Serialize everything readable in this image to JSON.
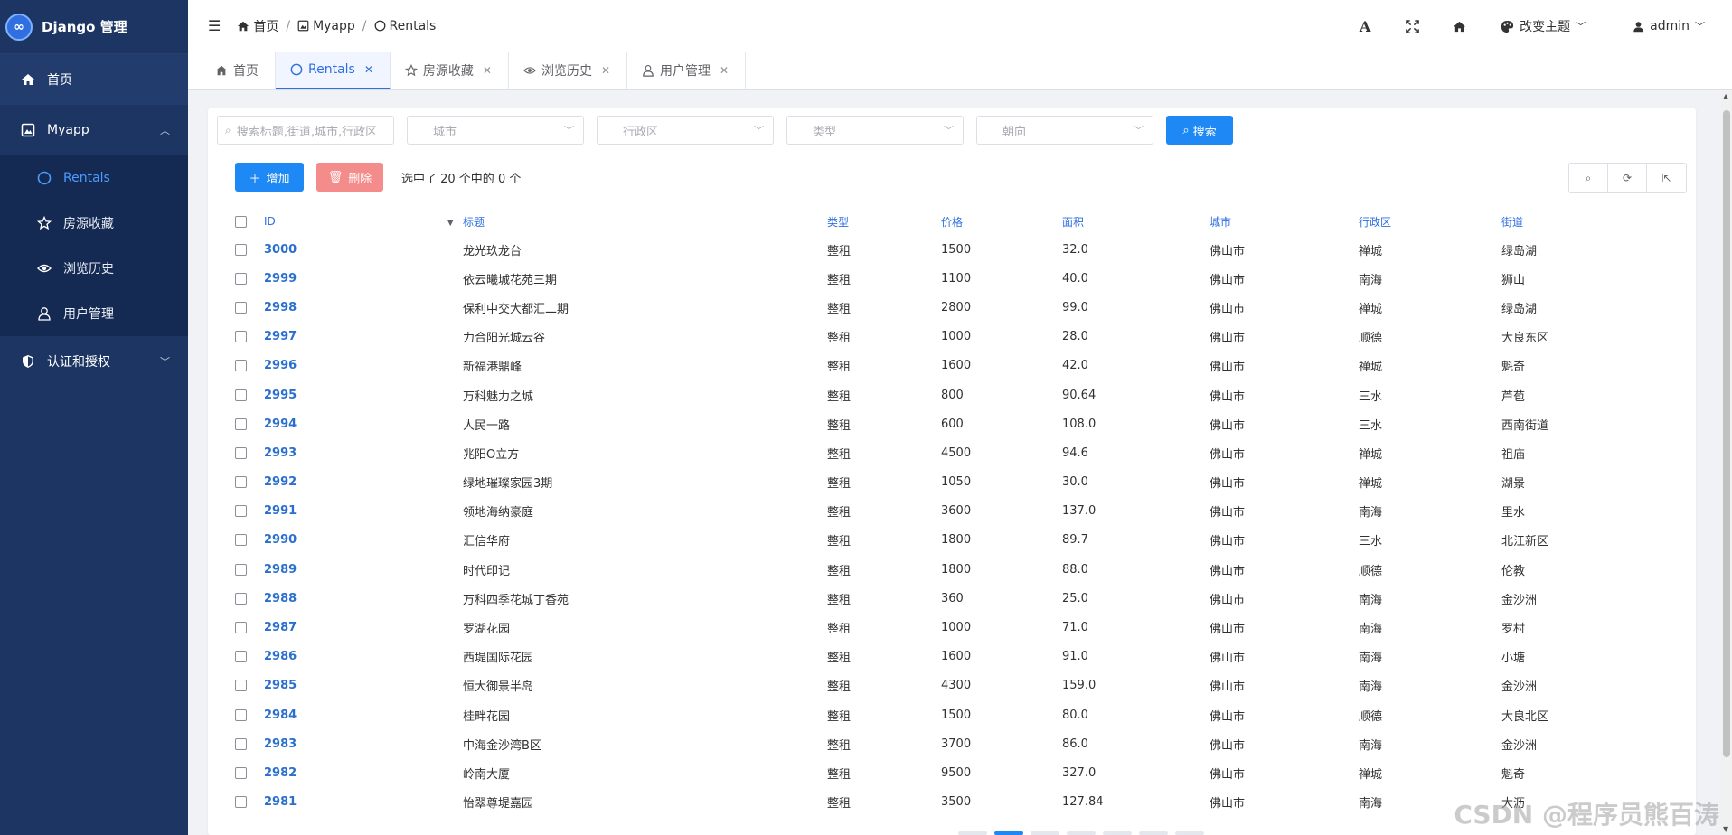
{
  "sidebar": {
    "brand": "Django 管理",
    "items": [
      {
        "label": "首页"
      },
      {
        "label": "Myapp"
      },
      {
        "label": "认证和授权"
      }
    ],
    "sub_items": [
      {
        "label": "Rentals"
      },
      {
        "label": "房源收藏"
      },
      {
        "label": "浏览历史"
      },
      {
        "label": "用户管理"
      }
    ]
  },
  "header": {
    "breadcrumb": [
      {
        "label": "首页"
      },
      {
        "label": "Myapp"
      },
      {
        "label": "Rentals"
      }
    ],
    "theme_label": "改变主题",
    "user_label": "admin"
  },
  "tabs": [
    {
      "label": "首页"
    },
    {
      "label": "Rentals"
    },
    {
      "label": "房源收藏"
    },
    {
      "label": "浏览历史"
    },
    {
      "label": "用户管理"
    }
  ],
  "filters": {
    "search_placeholder": "搜索标题,街道,城市,行政区",
    "city_placeholder": "城市",
    "district_placeholder": "行政区",
    "type_placeholder": "类型",
    "orientation_placeholder": "朝向",
    "search_button": "搜索"
  },
  "actions": {
    "add_label": "增加",
    "delete_label": "删除",
    "selection_text": "选中了 20 个中的 0 个"
  },
  "table": {
    "columns": [
      "ID",
      "标题",
      "类型",
      "价格",
      "面积",
      "城市",
      "行政区",
      "街道"
    ],
    "rows": [
      {
        "id": "3000",
        "title": "龙光玖龙台",
        "type": "整租",
        "price": "1500",
        "area": "32.0",
        "city": "佛山市",
        "district": "禅城",
        "street": "绿岛湖"
      },
      {
        "id": "2999",
        "title": "依云曦城花苑三期",
        "type": "整租",
        "price": "1100",
        "area": "40.0",
        "city": "佛山市",
        "district": "南海",
        "street": "狮山"
      },
      {
        "id": "2998",
        "title": "保利中交大都汇二期",
        "type": "整租",
        "price": "2800",
        "area": "99.0",
        "city": "佛山市",
        "district": "禅城",
        "street": "绿岛湖"
      },
      {
        "id": "2997",
        "title": "力合阳光城云谷",
        "type": "整租",
        "price": "1000",
        "area": "28.0",
        "city": "佛山市",
        "district": "顺德",
        "street": "大良东区"
      },
      {
        "id": "2996",
        "title": "新福港鼎峰",
        "type": "整租",
        "price": "1600",
        "area": "42.0",
        "city": "佛山市",
        "district": "禅城",
        "street": "魁奇"
      },
      {
        "id": "2995",
        "title": "万科魅力之城",
        "type": "整租",
        "price": "800",
        "area": "90.64",
        "city": "佛山市",
        "district": "三水",
        "street": "芦苞"
      },
      {
        "id": "2994",
        "title": "人民一路",
        "type": "整租",
        "price": "600",
        "area": "108.0",
        "city": "佛山市",
        "district": "三水",
        "street": "西南街道"
      },
      {
        "id": "2993",
        "title": "兆阳O立方",
        "type": "整租",
        "price": "4500",
        "area": "94.6",
        "city": "佛山市",
        "district": "禅城",
        "street": "祖庙"
      },
      {
        "id": "2992",
        "title": "绿地璀璨家园3期",
        "type": "整租",
        "price": "1050",
        "area": "30.0",
        "city": "佛山市",
        "district": "禅城",
        "street": "湖景"
      },
      {
        "id": "2991",
        "title": "领地海纳豪庭",
        "type": "整租",
        "price": "3600",
        "area": "137.0",
        "city": "佛山市",
        "district": "南海",
        "street": "里水"
      },
      {
        "id": "2990",
        "title": "汇信华府",
        "type": "整租",
        "price": "1800",
        "area": "89.7",
        "city": "佛山市",
        "district": "三水",
        "street": "北江新区"
      },
      {
        "id": "2989",
        "title": "时代印记",
        "type": "整租",
        "price": "1800",
        "area": "88.0",
        "city": "佛山市",
        "district": "顺德",
        "street": "伦教"
      },
      {
        "id": "2988",
        "title": "万科四季花城丁香苑",
        "type": "整租",
        "price": "360",
        "area": "25.0",
        "city": "佛山市",
        "district": "南海",
        "street": "金沙洲"
      },
      {
        "id": "2987",
        "title": "罗湖花园",
        "type": "整租",
        "price": "1000",
        "area": "71.0",
        "city": "佛山市",
        "district": "南海",
        "street": "罗村"
      },
      {
        "id": "2986",
        "title": "西堤国际花园",
        "type": "整租",
        "price": "1600",
        "area": "91.0",
        "city": "佛山市",
        "district": "南海",
        "street": "小塘"
      },
      {
        "id": "2985",
        "title": "恒大御景半岛",
        "type": "整租",
        "price": "4300",
        "area": "159.0",
        "city": "佛山市",
        "district": "南海",
        "street": "金沙洲"
      },
      {
        "id": "2984",
        "title": "桂畔花园",
        "type": "整租",
        "price": "1500",
        "area": "80.0",
        "city": "佛山市",
        "district": "顺德",
        "street": "大良北区"
      },
      {
        "id": "2983",
        "title": "中海金沙湾B区",
        "type": "整租",
        "price": "3700",
        "area": "86.0",
        "city": "佛山市",
        "district": "南海",
        "street": "金沙洲"
      },
      {
        "id": "2982",
        "title": "岭南大厦",
        "type": "整租",
        "price": "9500",
        "area": "327.0",
        "city": "佛山市",
        "district": "禅城",
        "street": "魁奇"
      },
      {
        "id": "2981",
        "title": "怡翠尊堤嘉园",
        "type": "整租",
        "price": "3500",
        "area": "127.84",
        "city": "佛山市",
        "district": "南海",
        "street": "大沥"
      }
    ]
  },
  "watermark": "CSDN @程序员熊百涛",
  "colors": {
    "sidebar_bg": "#1d3563",
    "accent": "#1e88f5",
    "delete": "#f48c8c",
    "link": "#2a6fcf"
  }
}
